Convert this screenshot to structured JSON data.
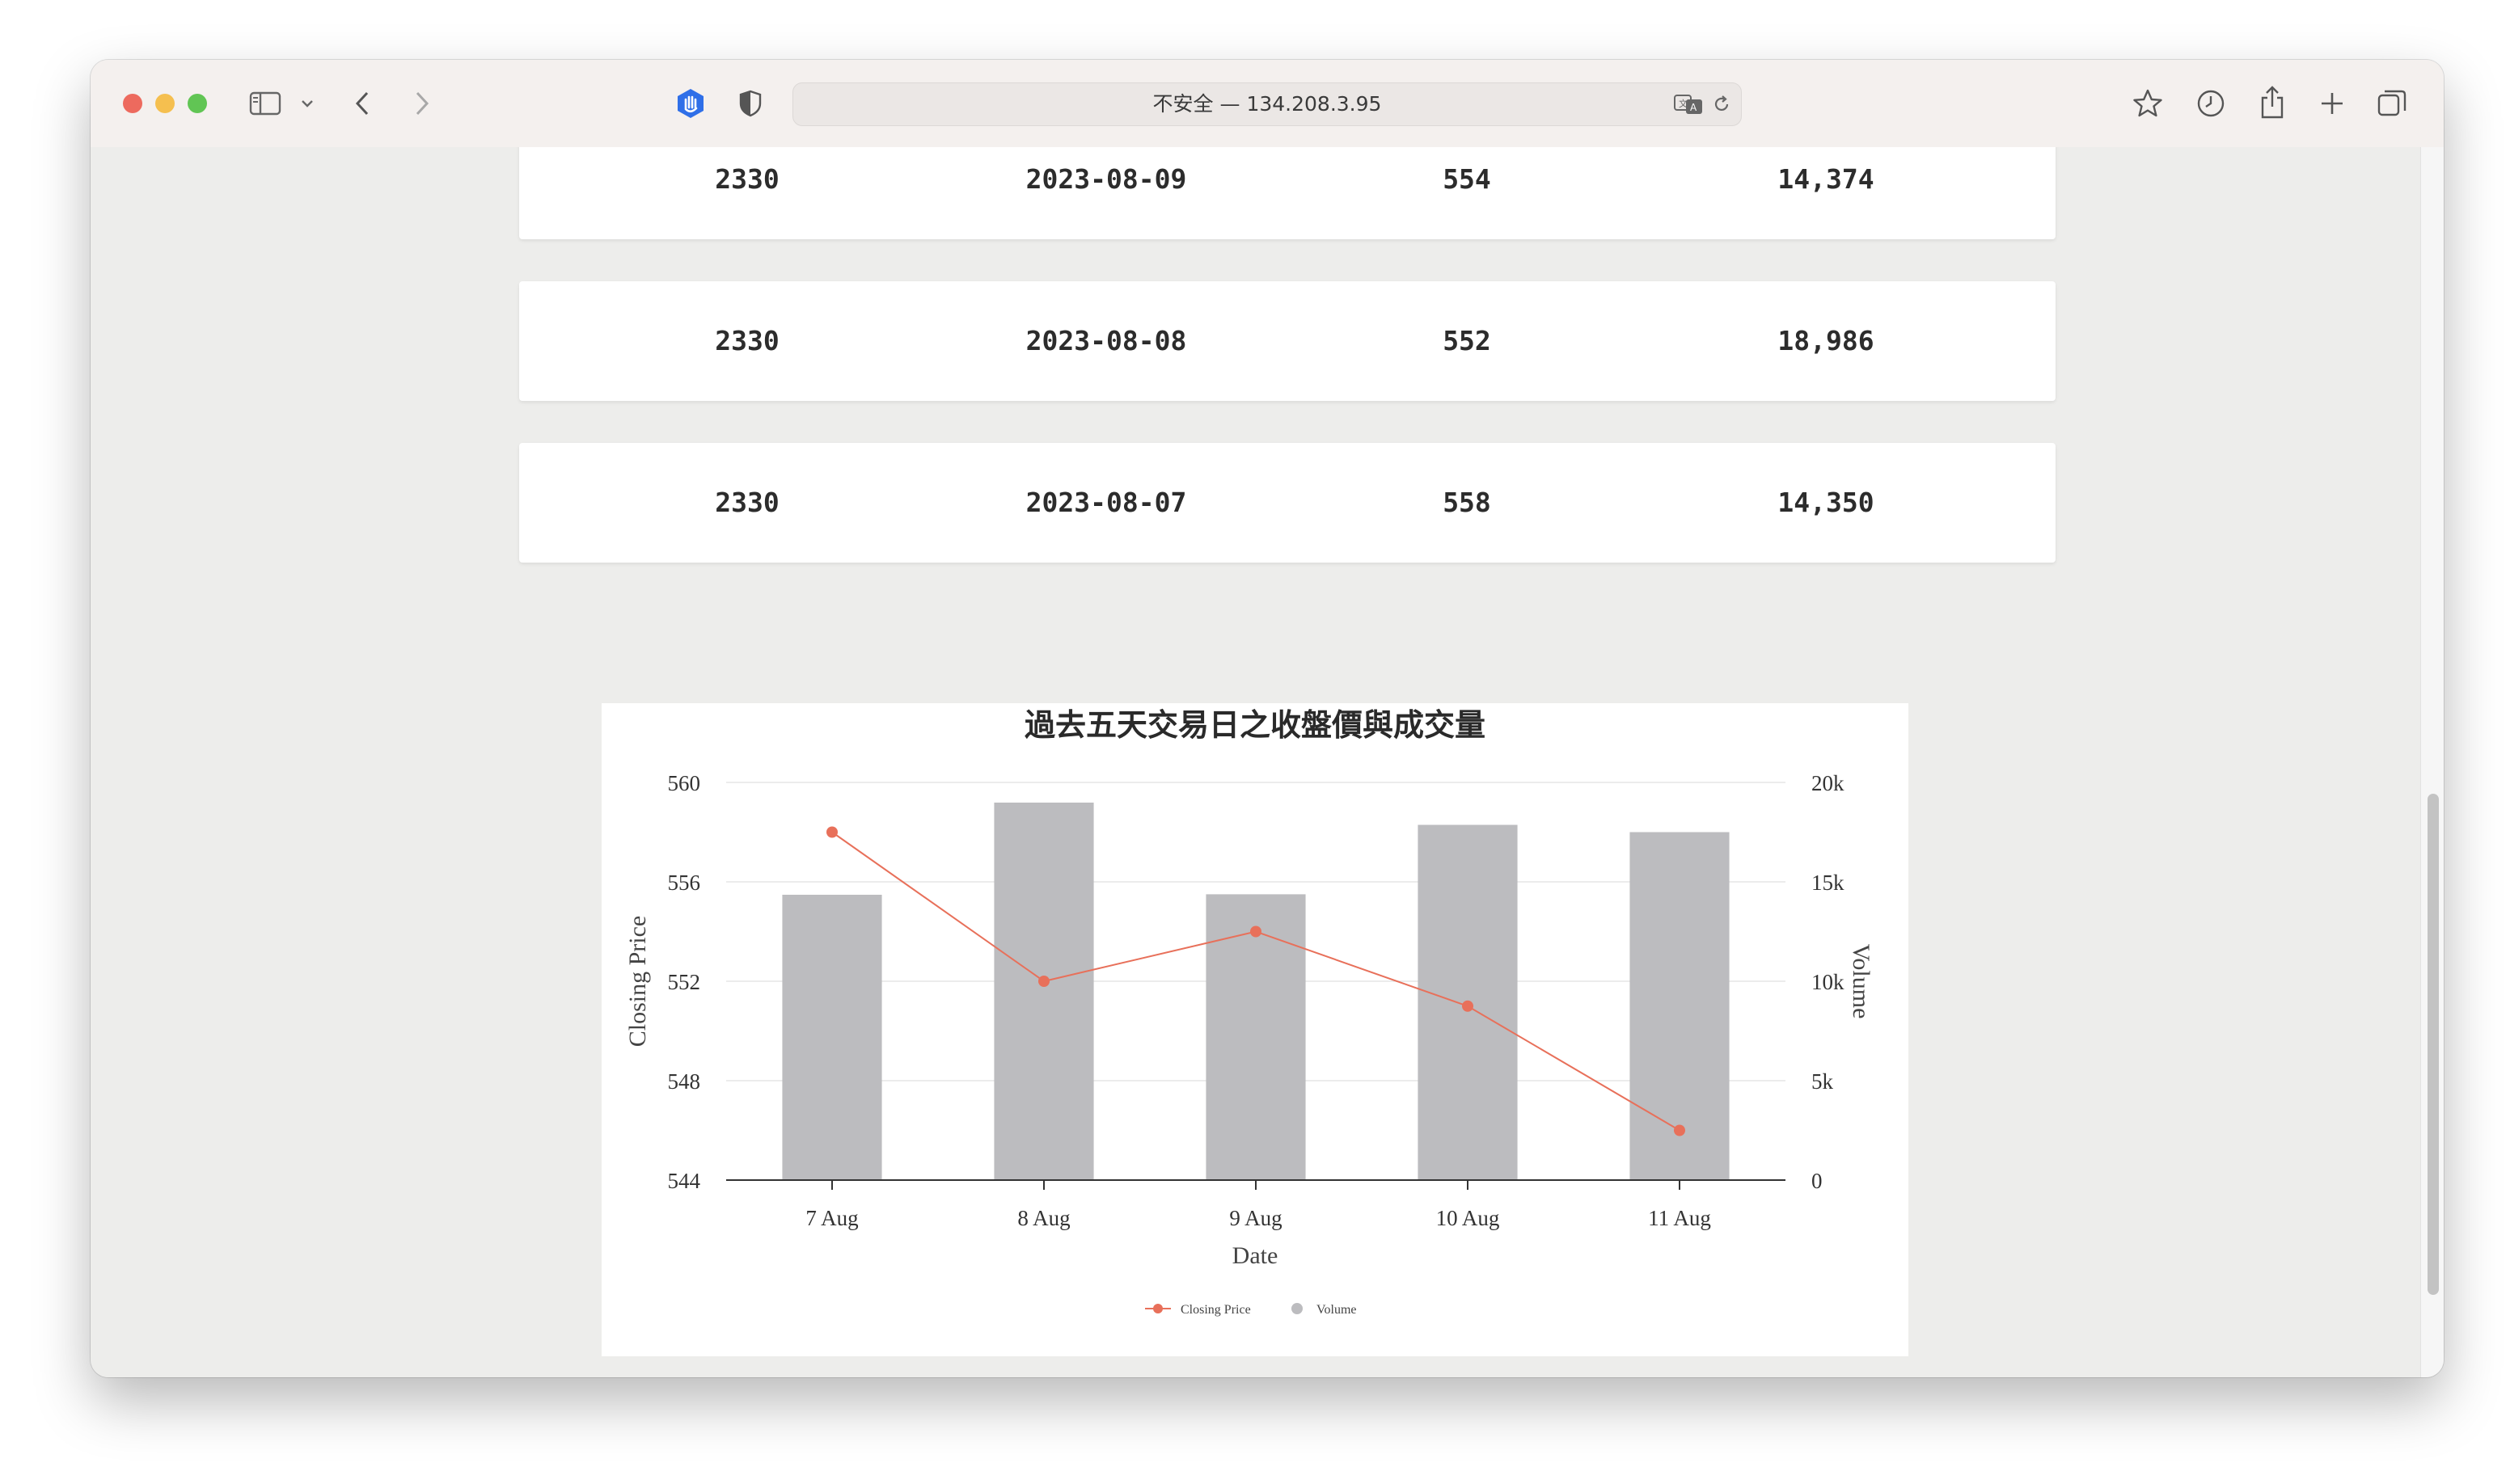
{
  "browser": {
    "url_text": "不安全 — 134.208.3.95"
  },
  "table_rows": [
    {
      "code": "2330",
      "date": "2023-08-09",
      "price": "554",
      "volume": "14,374"
    },
    {
      "code": "2330",
      "date": "2023-08-08",
      "price": "552",
      "volume": "18,986"
    },
    {
      "code": "2330",
      "date": "2023-08-07",
      "price": "558",
      "volume": "14,350"
    }
  ],
  "chart_data": {
    "type": "bar",
    "title": "過去五天交易日之收盤價與成交量",
    "xlabel": "Date",
    "ylabel": "Closing Price",
    "y2label": "Volume",
    "categories": [
      "7 Aug",
      "8 Aug",
      "9 Aug",
      "10 Aug",
      "11 Aug"
    ],
    "ylim": [
      544,
      560
    ],
    "y_ticks": [
      "560",
      "556",
      "552",
      "548",
      "544"
    ],
    "y2lim": [
      0,
      20000
    ],
    "y2_ticks": [
      "20k",
      "15k",
      "10k",
      "5k",
      "0"
    ],
    "grid": true,
    "legend_position": "bottom",
    "series": [
      {
        "name": "Closing Price",
        "type": "line",
        "axis": "left",
        "color": "#e8705a",
        "values": [
          558,
          552,
          554,
          551,
          546
        ]
      },
      {
        "name": "Volume",
        "type": "bar",
        "axis": "right",
        "color": "#bcbcbf",
        "values": [
          14350,
          18986,
          14374,
          17865,
          17500
        ]
      }
    ]
  }
}
